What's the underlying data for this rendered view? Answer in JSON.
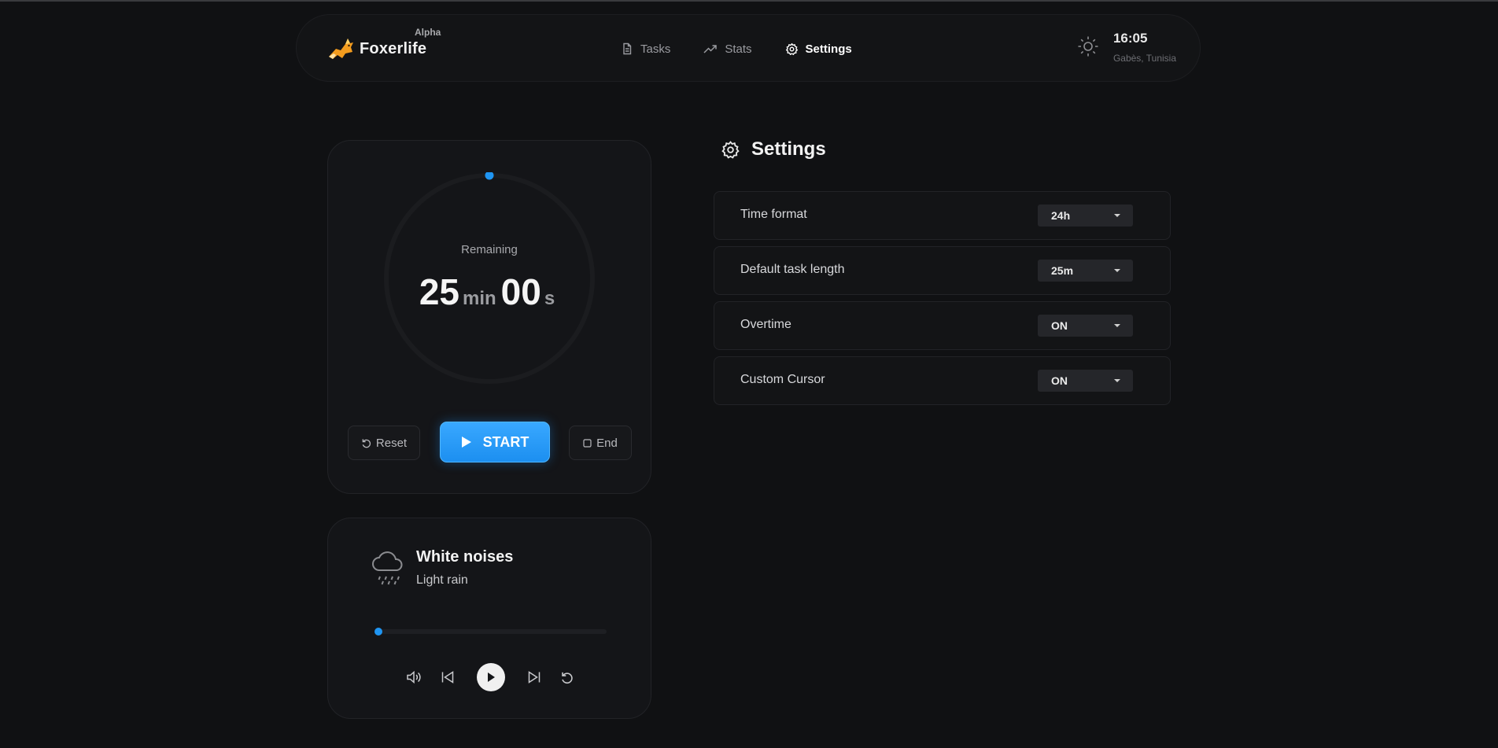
{
  "header": {
    "brand_name": "Foxerlife",
    "brand_tag": "Alpha",
    "nav": [
      {
        "label": "Tasks",
        "icon": "document-icon",
        "active": false
      },
      {
        "label": "Stats",
        "icon": "trend-up-icon",
        "active": false
      },
      {
        "label": "Settings",
        "icon": "gear-icon",
        "active": true
      }
    ],
    "clock": {
      "time": "16:05",
      "location": "Gabès, Tunisia"
    }
  },
  "timer": {
    "remaining_label": "Remaining",
    "minutes": "25",
    "min_unit": "min",
    "seconds": "00",
    "sec_unit": "s",
    "progress": 0,
    "reset_label": "Reset",
    "start_label": "START",
    "end_label": "End"
  },
  "white_noise": {
    "title": "White noises",
    "track": "Light rain",
    "progress": 0
  },
  "settings": {
    "title": "Settings",
    "rows": [
      {
        "label": "Time format",
        "value": "24h"
      },
      {
        "label": "Default task length",
        "value": "25m"
      },
      {
        "label": "Overtime",
        "value": "ON"
      },
      {
        "label": "Custom Cursor",
        "value": "ON"
      }
    ]
  },
  "colors": {
    "background": "#101113",
    "accent": "#1f95f2",
    "card": "#141518"
  }
}
